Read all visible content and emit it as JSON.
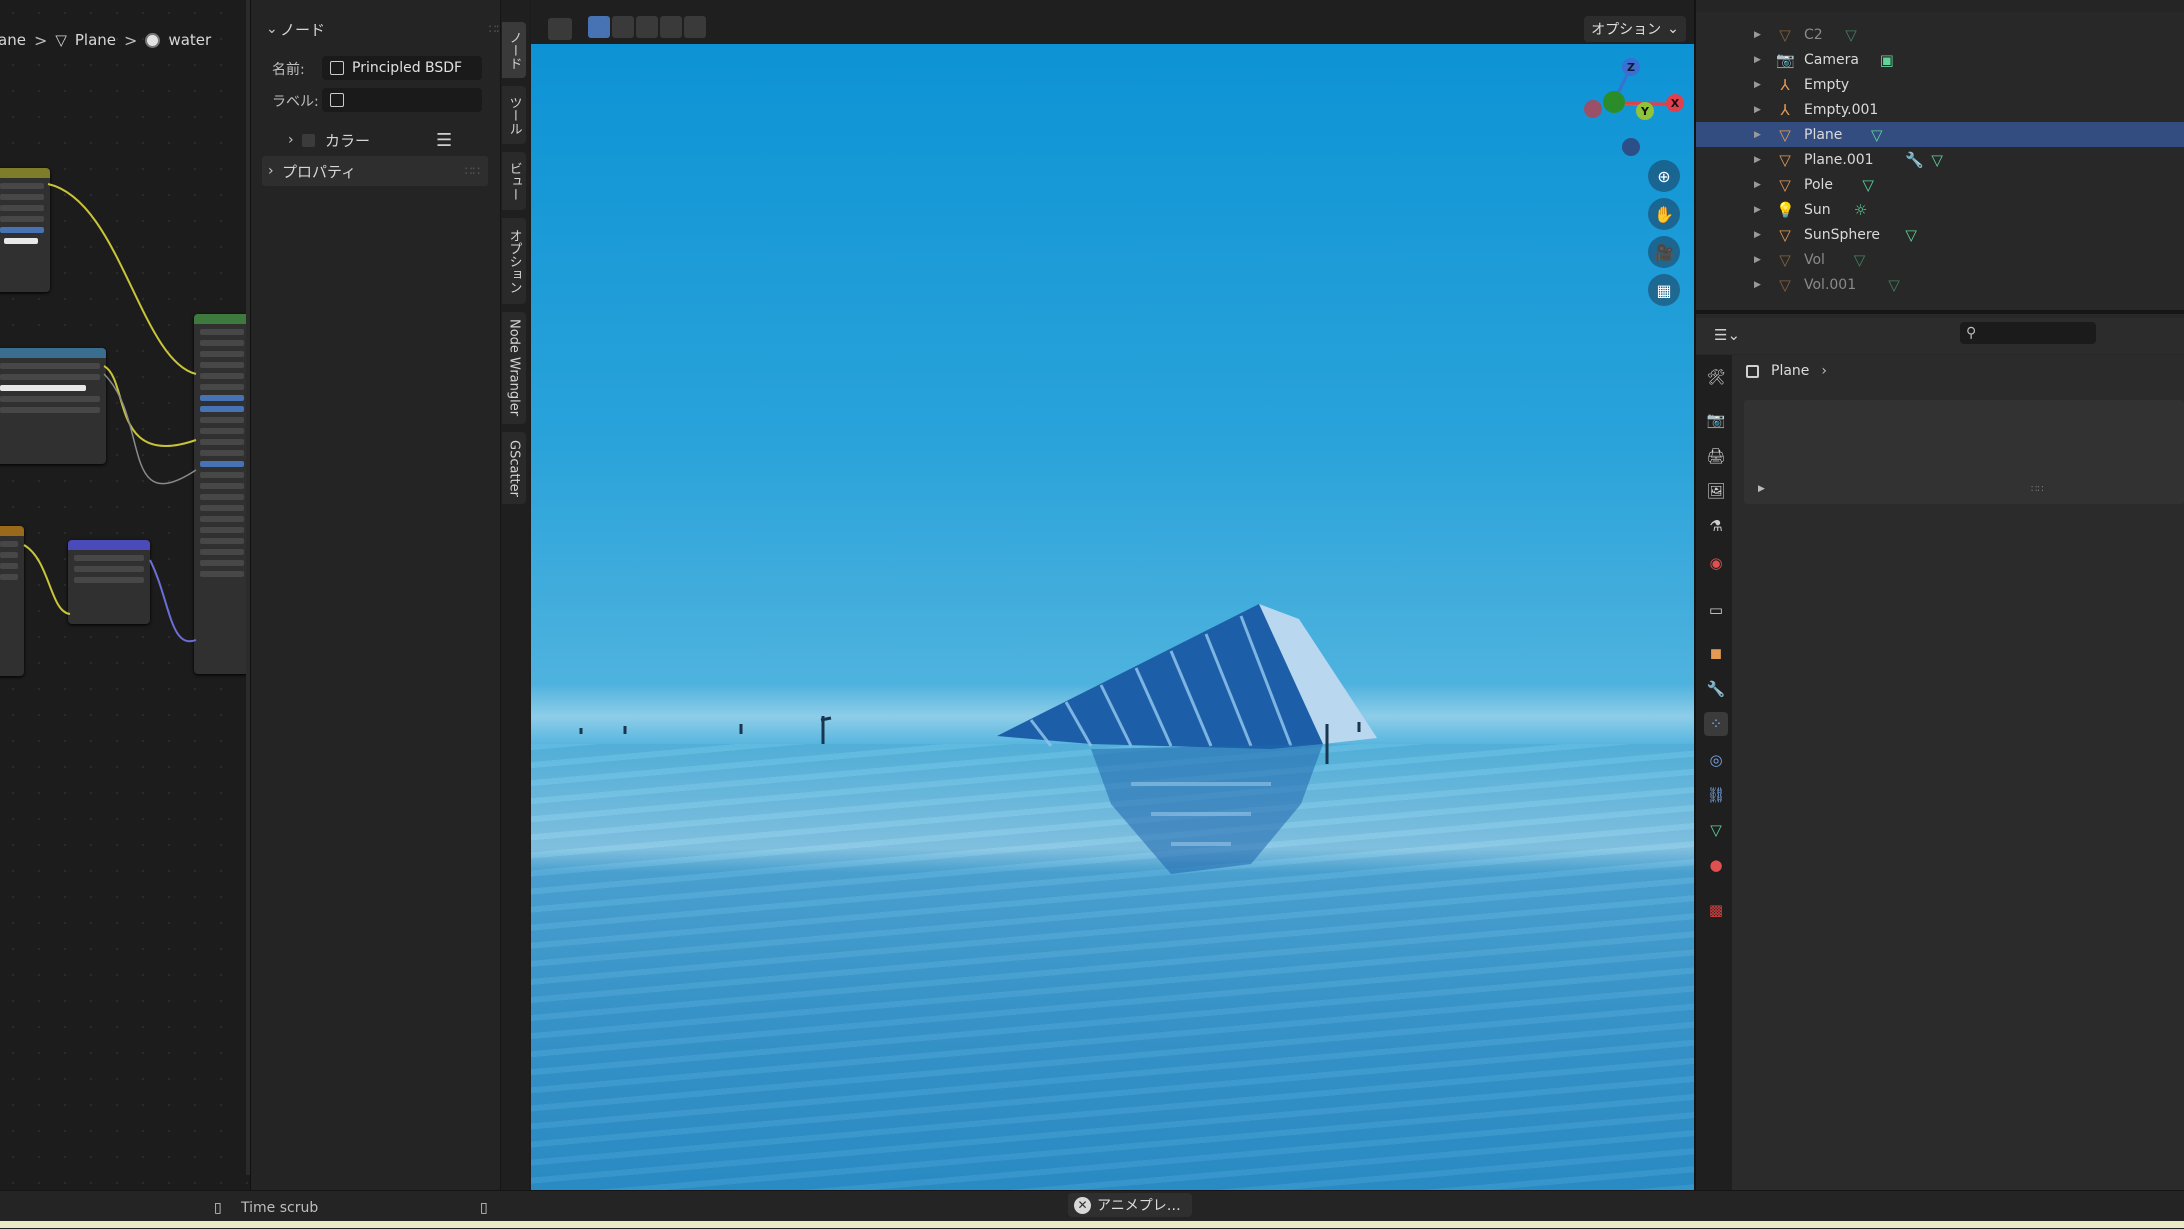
{
  "node_editor": {
    "breadcrumb": [
      {
        "icon": "object-icon",
        "label": "ane"
      },
      {
        "icon": "mesh-icon",
        "label": "Plane"
      },
      {
        "icon": "material-sphere-icon",
        "label": "water"
      }
    ]
  },
  "sidebar": {
    "node_panel_title": "ノード",
    "name_label": "名前:",
    "name_value": "Principled BSDF",
    "label_label": "ラベル:",
    "label_value": "",
    "color_section": "カラー",
    "properties_section": "プロパティ",
    "tabs": [
      "ノード",
      "ツール",
      "ビュー",
      "オプション",
      "Node Wrangler",
      "GScatter"
    ]
  },
  "viewport": {
    "options_label": "オプション",
    "gizmo_axes": [
      "Z",
      "Y",
      "X"
    ]
  },
  "outliner": {
    "items": [
      {
        "name": "C2",
        "icon": "mesh-triangle-icon",
        "data_icon": "mesh-data-icon",
        "dim": true,
        "selected": false
      },
      {
        "name": "Camera",
        "icon": "camera-object-icon",
        "data_icon": "camera-data-icon",
        "dim": false,
        "selected": false
      },
      {
        "name": "Empty",
        "icon": "empty-axes-icon",
        "data_icon": "",
        "dim": false,
        "selected": false
      },
      {
        "name": "Empty.001",
        "icon": "empty-axes-icon",
        "data_icon": "",
        "dim": false,
        "selected": false
      },
      {
        "name": "Plane",
        "icon": "mesh-triangle-icon",
        "data_icon": "mesh-data-icon",
        "dim": false,
        "selected": true
      },
      {
        "name": "Plane.001",
        "icon": "mesh-triangle-icon",
        "data_icon": "modifier-wrench-icon",
        "dim": false,
        "selected": false
      },
      {
        "name": "Pole",
        "icon": "mesh-triangle-icon",
        "data_icon": "mesh-data-icon",
        "dim": false,
        "selected": false
      },
      {
        "name": "Sun",
        "icon": "light-object-icon",
        "data_icon": "sun-light-data-icon",
        "dim": false,
        "selected": false
      },
      {
        "name": "SunSphere",
        "icon": "mesh-triangle-icon",
        "data_icon": "mesh-data-icon",
        "dim": false,
        "selected": false
      },
      {
        "name": "Vol",
        "icon": "mesh-triangle-icon",
        "data_icon": "mesh-data-icon",
        "dim": true,
        "selected": false
      },
      {
        "name": "Vol.001",
        "icon": "mesh-triangle-icon",
        "data_icon": "mesh-data-icon",
        "dim": true,
        "selected": false
      }
    ]
  },
  "properties": {
    "breadcrumb_object": "Plane",
    "search_placeholder": "",
    "tabs": [
      "tool-icon",
      "render-icon",
      "output-icon",
      "view-layer-icon",
      "scene-icon",
      "world-icon",
      "collection-icon",
      "object-icon",
      "modifier-wrench-icon",
      "particles-icon",
      "physics-icon",
      "constraints-icon",
      "object-data-icon",
      "material-icon",
      "texture-icon"
    ],
    "active_tab": "particles-icon"
  },
  "statusbar": {
    "time_scrub": "Time scrub",
    "job_label": "アニメプレ…"
  },
  "colors": {
    "selection": "#334d80",
    "accent_blue": "#4772b3",
    "sky": "#1497d6",
    "gizmo_x": "#e0404d",
    "gizmo_y": "#8ec43a",
    "gizmo_z": "#3b6fd1"
  }
}
